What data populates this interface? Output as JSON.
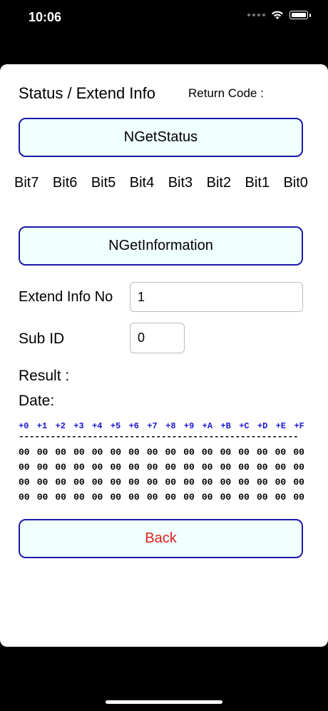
{
  "status_bar": {
    "time": "10:06"
  },
  "header": {
    "title": "Status / Extend Info",
    "return_code_label": "Return Code :"
  },
  "buttons": {
    "get_status": "NGetStatus",
    "get_information": "NGetInformation",
    "back": "Back"
  },
  "bits": [
    "Bit7",
    "Bit6",
    "Bit5",
    "Bit4",
    "Bit3",
    "Bit2",
    "Bit1",
    "Bit0"
  ],
  "form": {
    "extend_info_label": "Extend Info No",
    "extend_info_value": "1",
    "sub_id_label": "Sub ID",
    "sub_id_value": "0",
    "result_label": "Result :",
    "date_label": "Date:"
  },
  "hex": {
    "header": [
      "+0",
      "+1",
      "+2",
      "+3",
      "+4",
      "+5",
      "+6",
      "+7",
      "+8",
      "+9",
      "+A",
      "+B",
      "+C",
      "+D",
      "+E",
      "+F"
    ],
    "separator": "-----------------------------------------------------",
    "rows": [
      [
        "00",
        "00",
        "00",
        "00",
        "00",
        "00",
        "00",
        "00",
        "00",
        "00",
        "00",
        "00",
        "00",
        "00",
        "00",
        "00"
      ],
      [
        "00",
        "00",
        "00",
        "00",
        "00",
        "00",
        "00",
        "00",
        "00",
        "00",
        "00",
        "00",
        "00",
        "00",
        "00",
        "00"
      ],
      [
        "00",
        "00",
        "00",
        "00",
        "00",
        "00",
        "00",
        "00",
        "00",
        "00",
        "00",
        "00",
        "00",
        "00",
        "00",
        "00"
      ],
      [
        "00",
        "00",
        "00",
        "00",
        "00",
        "00",
        "00",
        "00",
        "00",
        "00",
        "00",
        "00",
        "00",
        "00",
        "00",
        "00"
      ]
    ]
  },
  "colors": {
    "accent_border": "#1a19a8",
    "button_bg": "#f0ffff",
    "back_text": "#e0201b",
    "hex_header": "#1b16d1"
  }
}
